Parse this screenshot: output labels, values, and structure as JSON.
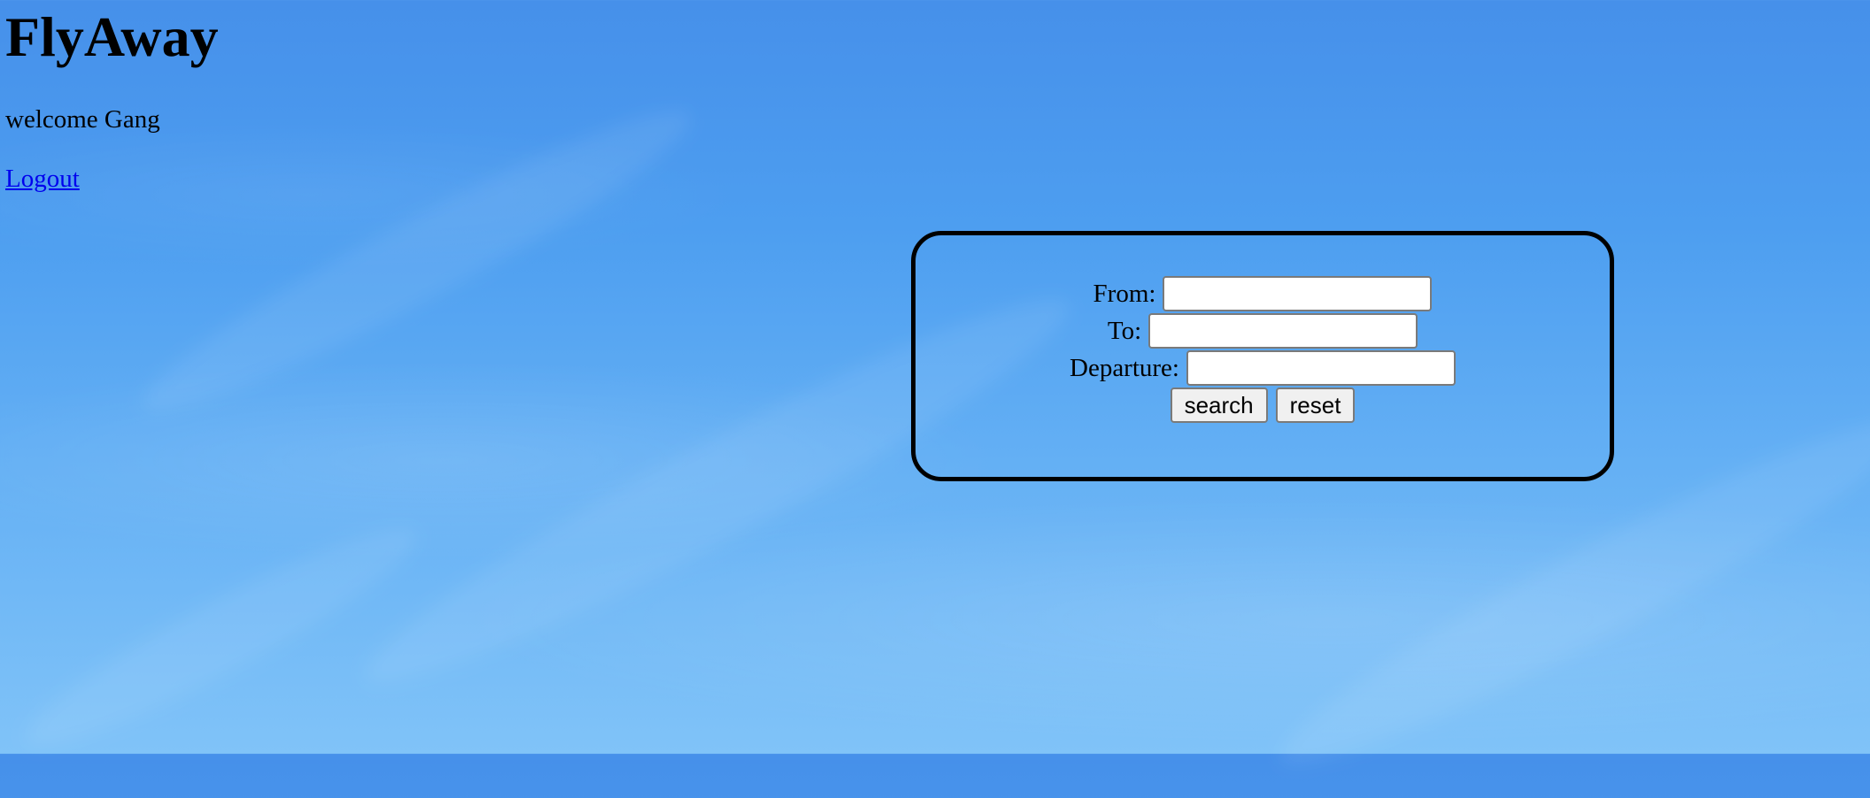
{
  "app": {
    "title": "FlyAway"
  },
  "header": {
    "welcome": "welcome Gang",
    "logout_label": "Logout"
  },
  "search_form": {
    "fields": [
      {
        "label": "From:",
        "value": "",
        "placeholder": ""
      },
      {
        "label": "To:",
        "value": "",
        "placeholder": ""
      },
      {
        "label": "Departure:",
        "value": "",
        "placeholder": ""
      }
    ],
    "search_label": "search",
    "reset_label": "reset"
  }
}
